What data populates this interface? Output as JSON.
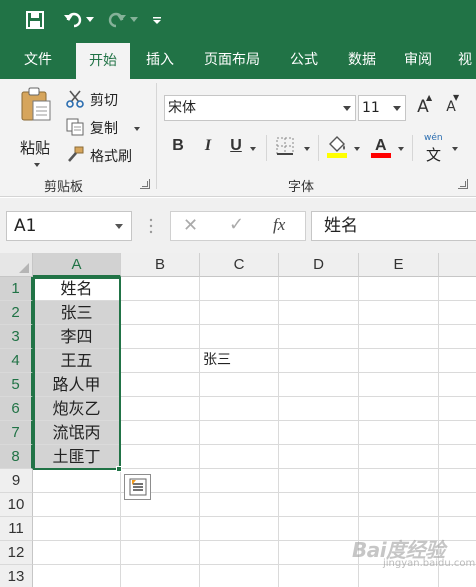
{
  "quick_access": {
    "save_icon": "save-icon",
    "undo_icon": "undo-icon",
    "redo_icon": "redo-icon",
    "customize_icon": "customize-qat-icon"
  },
  "tabs": [
    {
      "label": "文件",
      "active": false
    },
    {
      "label": "开始",
      "active": true
    },
    {
      "label": "插入",
      "active": false
    },
    {
      "label": "页面布局",
      "active": false
    },
    {
      "label": "公式",
      "active": false
    },
    {
      "label": "数据",
      "active": false
    },
    {
      "label": "审阅",
      "active": false
    },
    {
      "label": "视",
      "active": false
    }
  ],
  "ribbon": {
    "clipboard": {
      "paste_label": "粘贴",
      "cut_label": "剪切",
      "copy_label": "复制",
      "format_painter_label": "格式刷",
      "group_label": "剪贴板"
    },
    "font": {
      "font_name": "宋体",
      "font_size": "11",
      "bold_label": "B",
      "italic_label": "I",
      "underline_label": "U",
      "phonetic_label": "wén",
      "phonetic_char": "文",
      "group_label": "字体",
      "grow_label": "A",
      "shrink_label": "A",
      "fill_color": "#FFFF00",
      "font_color": "#FF0000"
    }
  },
  "formula_bar": {
    "name_box": "A1",
    "cancel_symbol": "✕",
    "enter_symbol": "✓",
    "fx_label": "fx",
    "content": "姓名"
  },
  "sheet": {
    "columns": [
      "A",
      "B",
      "C",
      "D",
      "E"
    ],
    "rows": [
      "1",
      "2",
      "3",
      "4",
      "5",
      "6",
      "7",
      "8",
      "9",
      "10",
      "11",
      "12",
      "13"
    ],
    "column_a": [
      "姓名",
      "张三",
      "李四",
      "王五",
      "路人甲",
      "炮灰乙",
      "流氓丙",
      "土匪丁"
    ],
    "c4": "张三",
    "selection_color": "#217346"
  },
  "watermark": {
    "text": "Bai度经验",
    "sub": "jingyan.baidu.com"
  }
}
